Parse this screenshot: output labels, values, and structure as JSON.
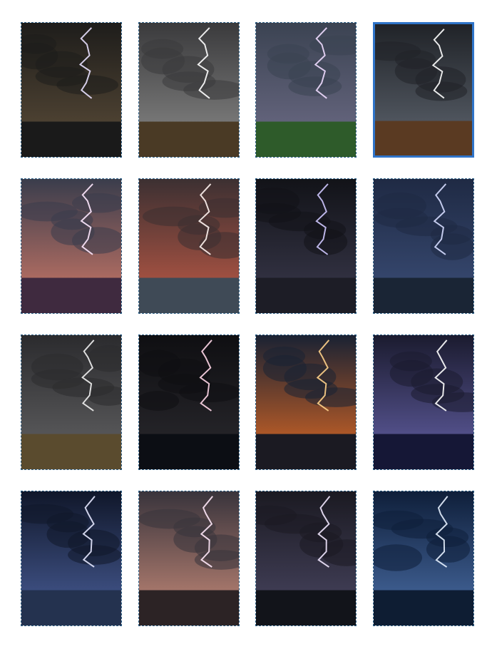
{
  "gallery": {
    "selected_index": 3,
    "tiles": [
      {
        "id": "storm-01",
        "scene": "dark-clouds-lightning-right",
        "sky_top": "#1e1d1b",
        "sky_bottom": "#5c4d39",
        "ground": "#1a1a1a",
        "bolt": "#e9e1ff"
      },
      {
        "id": "storm-02",
        "scene": "supercell-over-dirt-road",
        "sky_top": "#3a3a3c",
        "sky_bottom": "#8b8b8a",
        "ground": "#4a3a25",
        "bolt": "#ffffff"
      },
      {
        "id": "storm-03",
        "scene": "lightning-over-green-field",
        "sky_top": "#3b4352",
        "sky_bottom": "#6f6d88",
        "ground": "#2e5b2a",
        "bolt": "#f0dbff"
      },
      {
        "id": "storm-04",
        "scene": "storm-over-wheat-field",
        "sky_top": "#202328",
        "sky_bottom": "#5f6670",
        "ground": "#5a3a22",
        "bolt": "#ffffff"
      },
      {
        "id": "storm-05",
        "scene": "lightning-over-lavender-field",
        "sky_top": "#3a3d4c",
        "sky_bottom": "#d27a68",
        "ground": "#3f2a3f",
        "bolt": "#ffe9ff"
      },
      {
        "id": "storm-06",
        "scene": "cell-with-sunset-and-water",
        "sky_top": "#3c3032",
        "sky_bottom": "#c25b46",
        "ground": "#3f4a56",
        "bolt": "#fff3f0"
      },
      {
        "id": "storm-07",
        "scene": "night-lightning-over-lake",
        "sky_top": "#121318",
        "sky_bottom": "#3b3a4e",
        "ground": "#1d1d26",
        "bolt": "#cfc8ff"
      },
      {
        "id": "storm-08",
        "scene": "blue-storm-with-tree",
        "sky_top": "#1f2a44",
        "sky_bottom": "#3c4f79",
        "ground": "#1a2535",
        "bolt": "#d6ddff"
      },
      {
        "id": "storm-09",
        "scene": "grey-supercell-field",
        "sky_top": "#2b2b2e",
        "sky_bottom": "#646465",
        "ground": "#5a4b2e",
        "bolt": "#f1f1f1"
      },
      {
        "id": "storm-10",
        "scene": "black-clouds-over-sea",
        "sky_top": "#0f0f12",
        "sky_bottom": "#2b2a2f",
        "ground": "#0c0e14",
        "bolt": "#ffd7e8"
      },
      {
        "id": "storm-11",
        "scene": "fiery-lightning-tower",
        "sky_top": "#1a2233",
        "sky_bottom": "#e06a24",
        "ground": "#1b1a22",
        "bolt": "#ffd289"
      },
      {
        "id": "storm-12",
        "scene": "lightning-over-dark-sea",
        "sky_top": "#1b1b2f",
        "sky_bottom": "#6461a7",
        "ground": "#151736",
        "bolt": "#ffffff"
      },
      {
        "id": "storm-13",
        "scene": "lightning-over-rocky-shore",
        "sky_top": "#10172a",
        "sky_bottom": "#4a5f9a",
        "ground": "#24324f",
        "bolt": "#e6e8ff"
      },
      {
        "id": "storm-14",
        "scene": "pink-lightning-clouds",
        "sky_top": "#39343c",
        "sky_bottom": "#c98c7a",
        "ground": "#2c2325",
        "bolt": "#ffe8f8"
      },
      {
        "id": "storm-15",
        "scene": "lightning-over-calm-sea",
        "sky_top": "#1b1a22",
        "sky_bottom": "#4a4763",
        "ground": "#12141a",
        "bolt": "#f2e8ff"
      },
      {
        "id": "storm-16",
        "scene": "blue-night-storm-sea",
        "sky_top": "#0f1f3a",
        "sky_bottom": "#4b6fa8",
        "ground": "#0e1d33",
        "bolt": "#e8f2ff"
      }
    ]
  }
}
